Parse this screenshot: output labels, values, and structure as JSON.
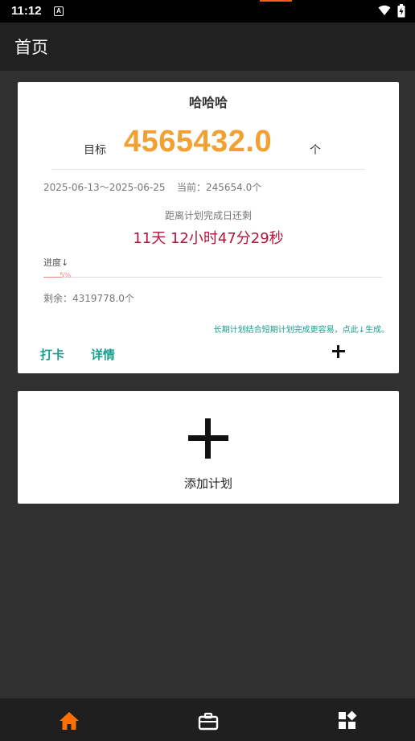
{
  "status_bar": {
    "time": "11:12",
    "notification_glyph": "A"
  },
  "app_bar": {
    "title": "首页"
  },
  "plan_card": {
    "title": "哈哈哈",
    "target_label": "目标",
    "target_value": "4565432.0",
    "target_unit": "个",
    "date_range": "2025-06-13～2025-06-25",
    "current": "当前：245654.0个",
    "remain_caption": "距离计划完成日还剩",
    "countdown": "11天  12小时47分29秒",
    "progress_label": "进度↓",
    "progress_percent_text": "5%",
    "progress_percent": 5,
    "remaining": "剩余：4319778.0个",
    "hint": "长期计划结合短期计划完成更容易，点此↓生成。",
    "checkin_label": "打卡",
    "detail_label": "详情"
  },
  "add_card": {
    "label": "添加计划"
  },
  "bottom_nav": {
    "items": [
      {
        "icon": "home-icon",
        "active": true
      },
      {
        "icon": "briefcase-icon",
        "active": false
      },
      {
        "icon": "apps-icon",
        "active": false
      }
    ]
  },
  "colors": {
    "accent": "#f2a032",
    "teal": "#1a9e8f",
    "countdown": "#b0153e",
    "progress": "#e88b7d",
    "active_nav": "#ff6f00"
  }
}
